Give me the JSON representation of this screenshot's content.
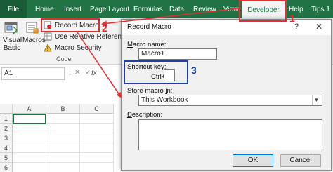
{
  "ribbon": {
    "tabs": [
      "File",
      "Home",
      "Insert",
      "Page Layout",
      "Formulas",
      "Data",
      "Review",
      "View",
      "Developer",
      "Help",
      "Tips 1"
    ],
    "visual_basic_label_1": "Visual",
    "visual_basic_label_2": "Basic",
    "macros_label": "Macros",
    "record_macro_label": "Record Macro",
    "use_relative_label": "Use Relative References",
    "macro_security_label": "Macro Security",
    "group_label": "Code"
  },
  "formula_bar": {
    "name_box": "A1",
    "separator": ":",
    "fx": "fx"
  },
  "grid": {
    "columns": [
      "A",
      "B",
      "C"
    ],
    "rows": [
      "1",
      "2",
      "3",
      "4",
      "5",
      "6"
    ]
  },
  "dialog": {
    "title": "Record Macro",
    "help": "?",
    "close": "✕",
    "macro_name_label_pre": "M",
    "macro_name_label_post": "acro name:",
    "macro_name_value": "Macro1",
    "shortcut_label_pre": "Shortcut ",
    "shortcut_label_u": "k",
    "shortcut_label_post": "ey:",
    "ctrl_label": "Ctrl+",
    "shortcut_value": "",
    "store_label_pre": "Store macro ",
    "store_label_u": "i",
    "store_label_post": "n:",
    "store_value": "This Workbook",
    "description_label_pre": "",
    "description_label_u": "D",
    "description_label_post": "escription:",
    "ok_label": "OK",
    "cancel_label": "Cancel"
  },
  "annotations": {
    "step1": "1",
    "step2": "2",
    "step3": "3"
  },
  "colors": {
    "excel_green": "#217346",
    "annotation_red": "#e03030",
    "annotation_blue": "#1f3fa6"
  }
}
